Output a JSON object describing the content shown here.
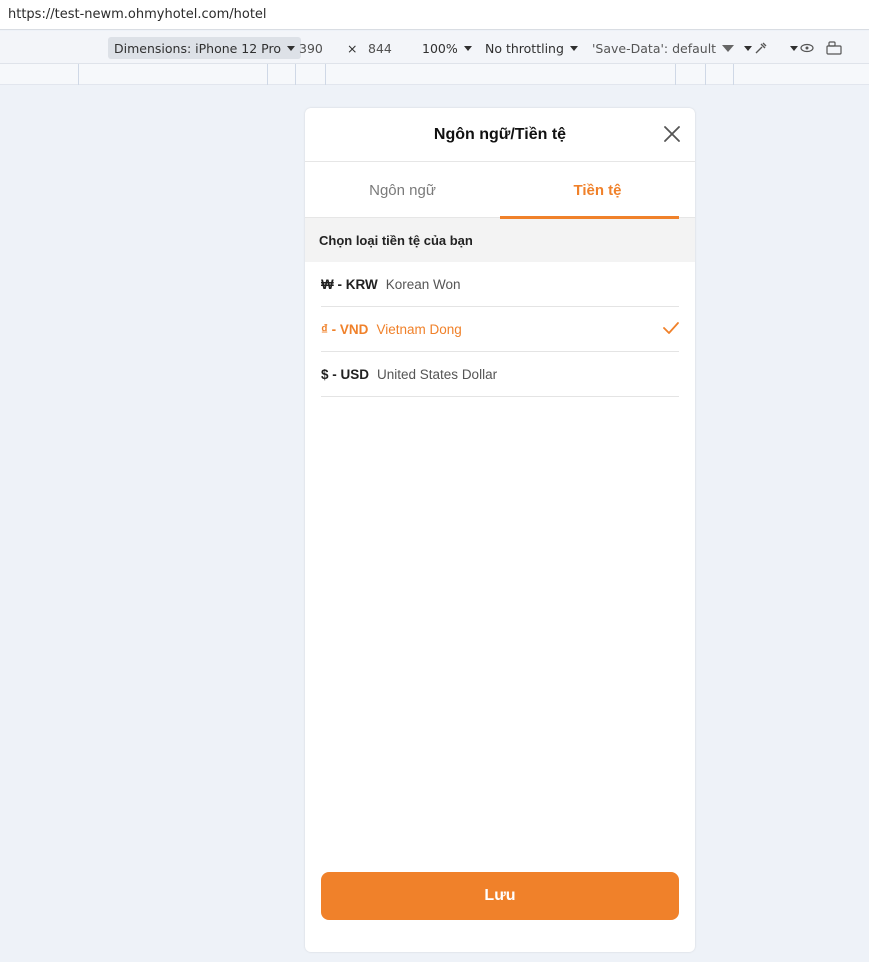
{
  "browser": {
    "url": "https://test-newm.ohmyhotel.com/hotel"
  },
  "devtools": {
    "dimensions_label": "Dimensions: iPhone 12 Pro",
    "width": "390",
    "times": "×",
    "height": "844",
    "zoom": "100%",
    "throttling": "No throttling",
    "save_data": "'Save-Data': default"
  },
  "modal": {
    "title": "Ngôn ngữ/Tiền tệ",
    "tabs": [
      {
        "label": "Ngôn ngữ",
        "active": false
      },
      {
        "label": "Tiền tệ",
        "active": true
      }
    ],
    "section_title": "Chọn loại tiền tệ của bạn",
    "currencies": [
      {
        "code": "₩ - KRW",
        "name": "Korean Won",
        "selected": false
      },
      {
        "code": "₫ - VND",
        "name": "Vietnam Dong",
        "selected": true
      },
      {
        "code": "$ - USD",
        "name": "United States Dollar",
        "selected": false
      }
    ],
    "save_label": "Lưu"
  },
  "colors": {
    "accent": "#f0812a",
    "page_bg": "#eef2f8"
  }
}
